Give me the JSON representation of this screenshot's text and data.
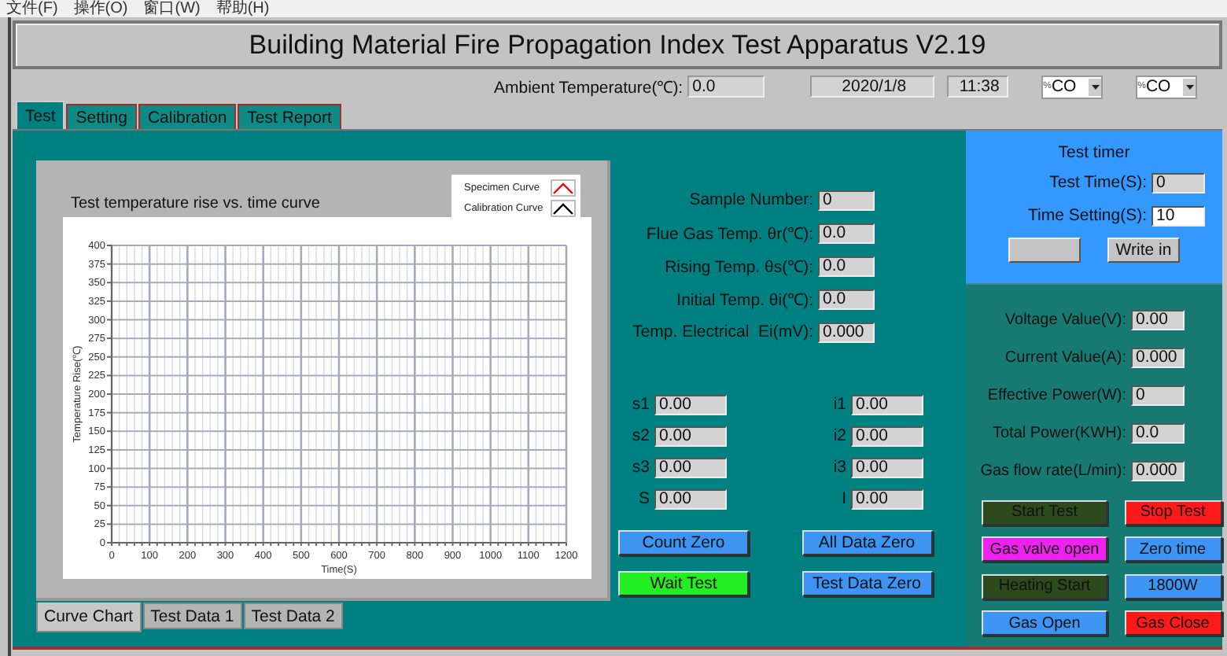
{
  "menu": [
    "文件(F)",
    "操作(O)",
    "窗口(W)",
    "帮助(H)"
  ],
  "title": "Building Material Fire Propagation Index Test Apparatus V2.19",
  "status_row": {
    "ambient_label": "Ambient Temperature(℃):",
    "ambient_value": "0.0",
    "date": "2020/1/8",
    "time": "11:38",
    "selectors": [
      {
        "prefix": "%",
        "value": "CO"
      },
      {
        "prefix": "%",
        "value": "CO"
      }
    ]
  },
  "tabs": [
    {
      "label": "Test",
      "selected": true
    },
    {
      "label": "Setting",
      "selected": false
    },
    {
      "label": "Calibration",
      "selected": false
    },
    {
      "label": "Test Report",
      "selected": false
    }
  ],
  "chart_panel": {
    "chart_data": {
      "type": "line",
      "title": "Test temperature rise vs. time curve",
      "xlabel": "Time(S)",
      "ylabel": "Temperature Rise(℃)",
      "categories": [
        "0",
        "100",
        "200",
        "300",
        "400",
        "500",
        "600",
        "700",
        "800",
        "900",
        "1000",
        "1100",
        "1200"
      ],
      "grid": true,
      "ylim": [
        0,
        400
      ],
      "yticks": [
        0,
        25,
        50,
        75,
        100,
        125,
        150,
        175,
        200,
        225,
        250,
        275,
        300,
        325,
        350,
        375,
        400
      ],
      "series": [
        {
          "name": "Specimen Curve",
          "color": "#ff0000",
          "values": [
            null,
            null,
            null,
            null,
            null,
            null,
            null,
            null,
            null,
            null,
            null,
            null,
            null
          ]
        },
        {
          "name": "Calibration Curve",
          "color": "#000000",
          "values": [
            null,
            null,
            null,
            null,
            null,
            null,
            null,
            null,
            null,
            null,
            null,
            null,
            null
          ]
        }
      ]
    },
    "tabs": [
      {
        "label": "Curve Chart",
        "selected": true
      },
      {
        "label": "Test Data 1",
        "selected": false
      },
      {
        "label": "Test Data 2",
        "selected": false
      }
    ]
  },
  "readings": [
    {
      "label": "Sample Number:",
      "value": "0"
    },
    {
      "label": "Flue Gas Temp. θr(℃):",
      "value": "0.0"
    },
    {
      "label": "Rising Temp. θs(℃):",
      "value": "0.0"
    },
    {
      "label": "Initial Temp. θi(℃):",
      "value": "0.0"
    },
    {
      "label": "Temp. Electrical  Ei(mV):",
      "value": "0.000"
    }
  ],
  "s_values": [
    {
      "label": "s1",
      "value": "0.00"
    },
    {
      "label": "s2",
      "value": "0.00"
    },
    {
      "label": "s3",
      "value": "0.00"
    },
    {
      "label": "S",
      "value": "0.00"
    }
  ],
  "i_values": [
    {
      "label": "i1",
      "value": "0.00"
    },
    {
      "label": "i2",
      "value": "0.00"
    },
    {
      "label": "i3",
      "value": "0.00"
    },
    {
      "label": "I",
      "value": "0.00"
    }
  ],
  "middle_buttons": [
    {
      "label": "Count Zero",
      "color": "#3d94f2"
    },
    {
      "label": "All Data Zero",
      "color": "#3d94f2"
    },
    {
      "label": "Wait Test",
      "color": "#22ee22"
    },
    {
      "label": "Test Data Zero",
      "color": "#3d94f2"
    }
  ],
  "timer": {
    "title": "Test timer",
    "test_time": {
      "label": "Test Time(S):",
      "value": "0"
    },
    "time_setting": {
      "label": "Time Setting(S):",
      "value": "10"
    },
    "buttons": [
      {
        "kind": "blank"
      },
      {
        "kind": "text",
        "label": "Write in"
      }
    ]
  },
  "power": [
    {
      "label": "Voltage Value(V):",
      "value": "0.00"
    },
    {
      "label": "Current Value(A):",
      "value": "0.000"
    },
    {
      "label": "Effective Power(W):",
      "value": "0"
    },
    {
      "label": "Total Power(KWH):",
      "value": "0.0"
    },
    {
      "label": "Gas flow rate(L/min):",
      "value": "0.000"
    }
  ],
  "control_buttons": [
    {
      "label": "Start Test",
      "color": "#2c4a1c"
    },
    {
      "label": "Stop Test",
      "color": "#ff1a1a"
    },
    {
      "label": "Gas valve open",
      "color": "#ee22ee"
    },
    {
      "label": "Zero time",
      "color": "#3d94f2"
    },
    {
      "label": "Heating Start",
      "color": "#2c4a1c"
    },
    {
      "label": "1800W",
      "color": "#3d94f2"
    },
    {
      "label": "Gas Open",
      "color": "#3d94f2"
    },
    {
      "label": "Gas Close",
      "color": "#ff1a1a"
    }
  ]
}
